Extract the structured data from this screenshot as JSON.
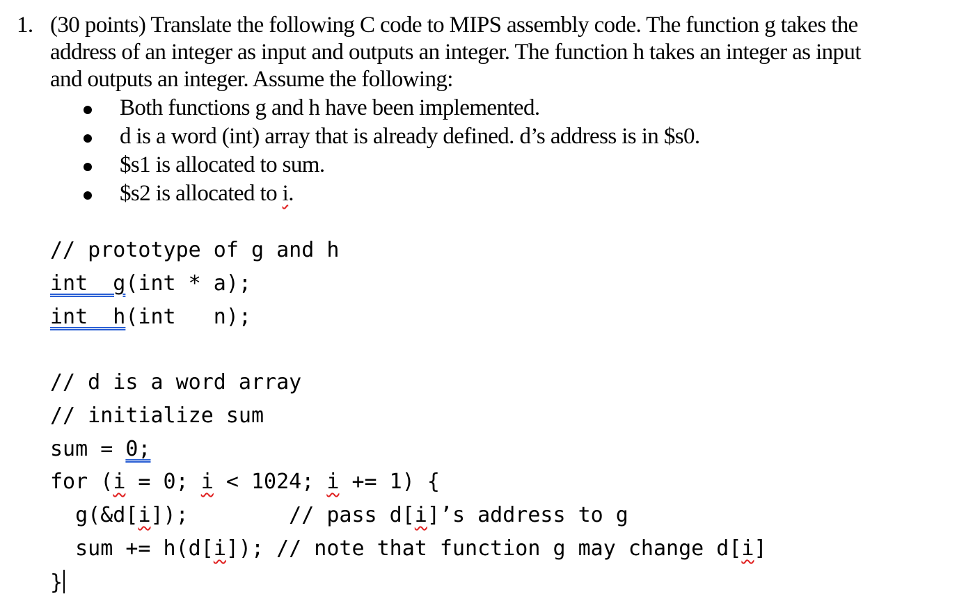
{
  "problem": {
    "number": "1.",
    "lines": [
      "(30 points) Translate the following C code to MIPS assembly code. The function g takes the",
      "address of an integer as input and outputs an integer. The function h takes an integer as input",
      "and outputs an integer. Assume the following:"
    ],
    "bullets": [
      "Both functions g and h have been implemented.",
      "d is a word (int) array that is already defined. d’s address is in $s0.",
      "$s1 is allocated to sum.",
      "$s2 is allocated to "
    ],
    "bullet4_var": "i",
    "bullet4_end": "."
  },
  "code": {
    "proto_comment": "// prototype of g and h",
    "proto_g_a": "int  g",
    "proto_g_b": "(int * a);",
    "proto_h_a": "int  h",
    "proto_h_b": "(int   n);",
    "comment1": "// d is a word array",
    "comment2": "// initialize sum",
    "sum_init_a": "sum = ",
    "sum_init_b": "0;",
    "for_parts": [
      "for (",
      "i",
      " = 0; ",
      "i",
      " < 1024; ",
      "i",
      " += 1) {"
    ],
    "g_call_parts": [
      "  g(&d[",
      "i",
      "]);        // pass d[",
      "i",
      "]’s address to g"
    ],
    "h_call_parts": [
      "  sum += h(d[",
      "i",
      "]); // note that function g may change d[",
      "i",
      "]"
    ],
    "close": "}"
  }
}
